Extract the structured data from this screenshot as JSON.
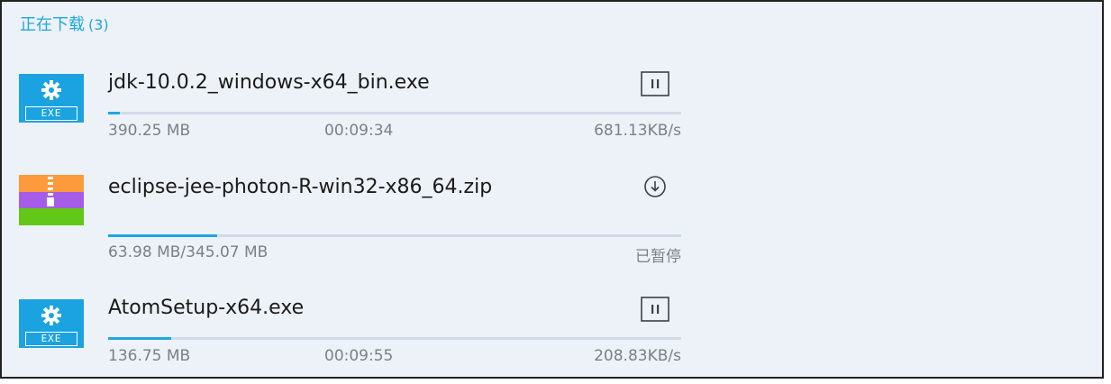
{
  "section": {
    "title": "正在下载",
    "count": "(3)"
  },
  "downloads": [
    {
      "file_type": "exe",
      "icon": "exe-gear-icon",
      "icon_label": "EXE",
      "name": "jdk-10.0.2_windows-x64_bin.exe",
      "size": "390.25 MB",
      "time_left": "00:09:34",
      "speed": "681.13KB/s",
      "progress": 0.02,
      "action": "pause",
      "action_icon": "pause-icon"
    },
    {
      "file_type": "zip",
      "icon": "zip-archive-icon",
      "name": "eclipse-jee-photon-R-win32-x86_64.zip",
      "size": "63.98 MB/345.07 MB",
      "status": "已暂停",
      "progress": 0.19,
      "action": "resume",
      "action_icon": "download-resume-icon"
    },
    {
      "file_type": "exe",
      "icon": "exe-gear-icon",
      "icon_label": "EXE",
      "name": "AtomSetup-x64.exe",
      "size": "136.75 MB",
      "time_left": "00:09:55",
      "speed": "208.83KB/s",
      "progress": 0.11,
      "action": "pause",
      "action_icon": "pause-icon"
    }
  ],
  "colors": {
    "accent": "#1ea7e1",
    "panel_background": "#edf2f8",
    "exe_icon": "#1ba3e1",
    "zip_orange": "#fd9a3c",
    "zip_purple": "#a55ce6",
    "zip_green": "#62c716",
    "text_primary": "#1a1a1a",
    "text_secondary": "#7b7f86"
  }
}
